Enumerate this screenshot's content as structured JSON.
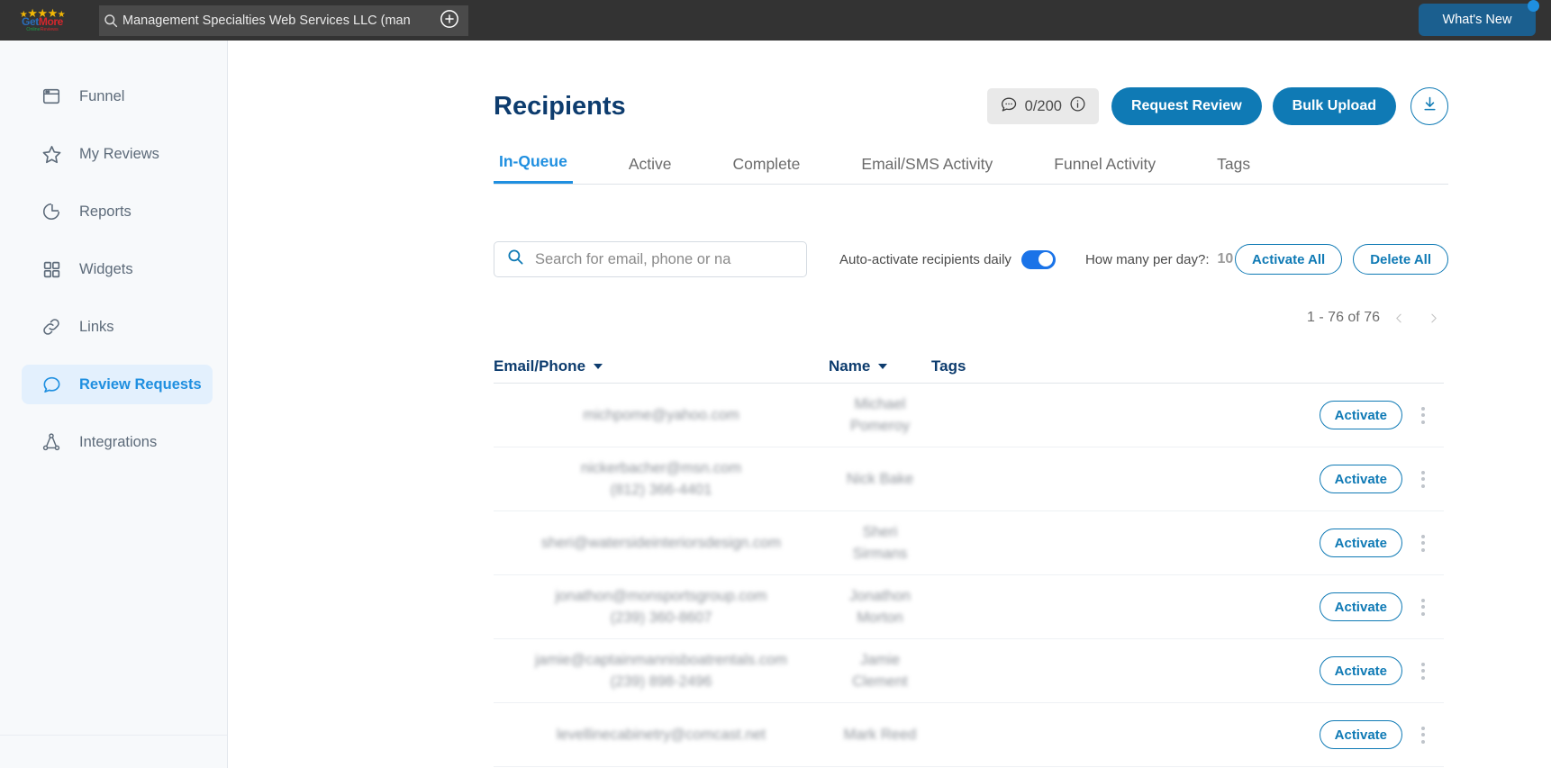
{
  "topbar": {
    "logo_stars": "★★★★★",
    "logo_name_get": "Get",
    "logo_name_more": "More",
    "logo_sub_online": "Online",
    "logo_sub_reviews": "Reviews",
    "account_search_value": "Management Specialties Web Services LLC (man",
    "add_account_icon": "plus-circle-icon",
    "search_icon": "search-icon",
    "whats_new_label": "What's New",
    "notification_dot": true
  },
  "sidebar": {
    "items": [
      {
        "label": "Funnel",
        "icon": "funnel-window-icon",
        "active": false
      },
      {
        "label": "My Reviews",
        "icon": "star-icon",
        "active": false
      },
      {
        "label": "Reports",
        "icon": "pie-chart-icon",
        "active": false
      },
      {
        "label": "Widgets",
        "icon": "grid-squares-icon",
        "active": false
      },
      {
        "label": "Links",
        "icon": "link-icon",
        "active": false
      },
      {
        "label": "Review Requests",
        "icon": "chat-bubble-icon",
        "active": true
      },
      {
        "label": "Integrations",
        "icon": "integrations-icon",
        "active": false
      }
    ]
  },
  "header": {
    "title": "Recipients",
    "quota": {
      "icon": "chat-bubble-icon",
      "value": "0/200",
      "info_icon": "info-circle-icon"
    },
    "request_review_label": "Request Review",
    "bulk_upload_label": "Bulk Upload",
    "download_icon": "download-icon"
  },
  "tabs": [
    {
      "label": "In-Queue",
      "active": true
    },
    {
      "label": "Active",
      "active": false
    },
    {
      "label": "Complete",
      "active": false
    },
    {
      "label": "Email/SMS Activity",
      "active": false
    },
    {
      "label": "Funnel Activity",
      "active": false
    },
    {
      "label": "Tags",
      "active": false
    }
  ],
  "filters": {
    "search_placeholder": "Search for email, phone or na",
    "search_value": "",
    "search_icon": "search-icon",
    "auto_activate_label": "Auto-activate recipients daily",
    "auto_activate_on": true,
    "per_day_label": "How many per day?:",
    "per_day_value": "10",
    "activate_all_label": "Activate All",
    "delete_all_label": "Delete All"
  },
  "pagination": {
    "range_text": "1 - 76 of 76",
    "prev_icon": "chevron-left-icon",
    "next_icon": "chevron-right-icon"
  },
  "table": {
    "columns": [
      {
        "label": "Email/Phone",
        "sortable": true
      },
      {
        "label": "Name",
        "sortable": true
      },
      {
        "label": "Tags",
        "sortable": false
      }
    ],
    "row_action_label": "Activate",
    "row_menu_icon": "kebab-menu-icon",
    "rows": [
      {
        "email": "michpome@yahoo.com",
        "phone": "",
        "name_line1": "Michael",
        "name_line2": "Pomeroy",
        "tags": ""
      },
      {
        "email": "nickerbacher@msn.com",
        "phone": "(812) 366-4401",
        "name_line1": "Nick Bake",
        "name_line2": "",
        "tags": ""
      },
      {
        "email": "sheri@watersideinteriorsdesign.com",
        "phone": "",
        "name_line1": "Sheri",
        "name_line2": "Sirmans",
        "tags": ""
      },
      {
        "email": "jonathon@monsportsgroup.com",
        "phone": "(239) 360-8607",
        "name_line1": "Jonathon",
        "name_line2": "Morton",
        "tags": ""
      },
      {
        "email": "jamie@captainmannisboatrentals.com",
        "phone": "(239) 898-2496",
        "name_line1": "Jamie",
        "name_line2": "Clement",
        "tags": ""
      },
      {
        "email": "levellinecabinetry@comcast.net",
        "phone": "",
        "name_line1": "Mark Reed",
        "name_line2": "",
        "tags": ""
      }
    ]
  },
  "colors": {
    "brand_blue": "#0f7ab5",
    "accent_blue": "#1f8fe0",
    "title_navy": "#0d3c6e",
    "topbar_dark": "#333333",
    "sidebar_bg": "#f7f9fb",
    "toggle_on": "#1a73e8"
  }
}
